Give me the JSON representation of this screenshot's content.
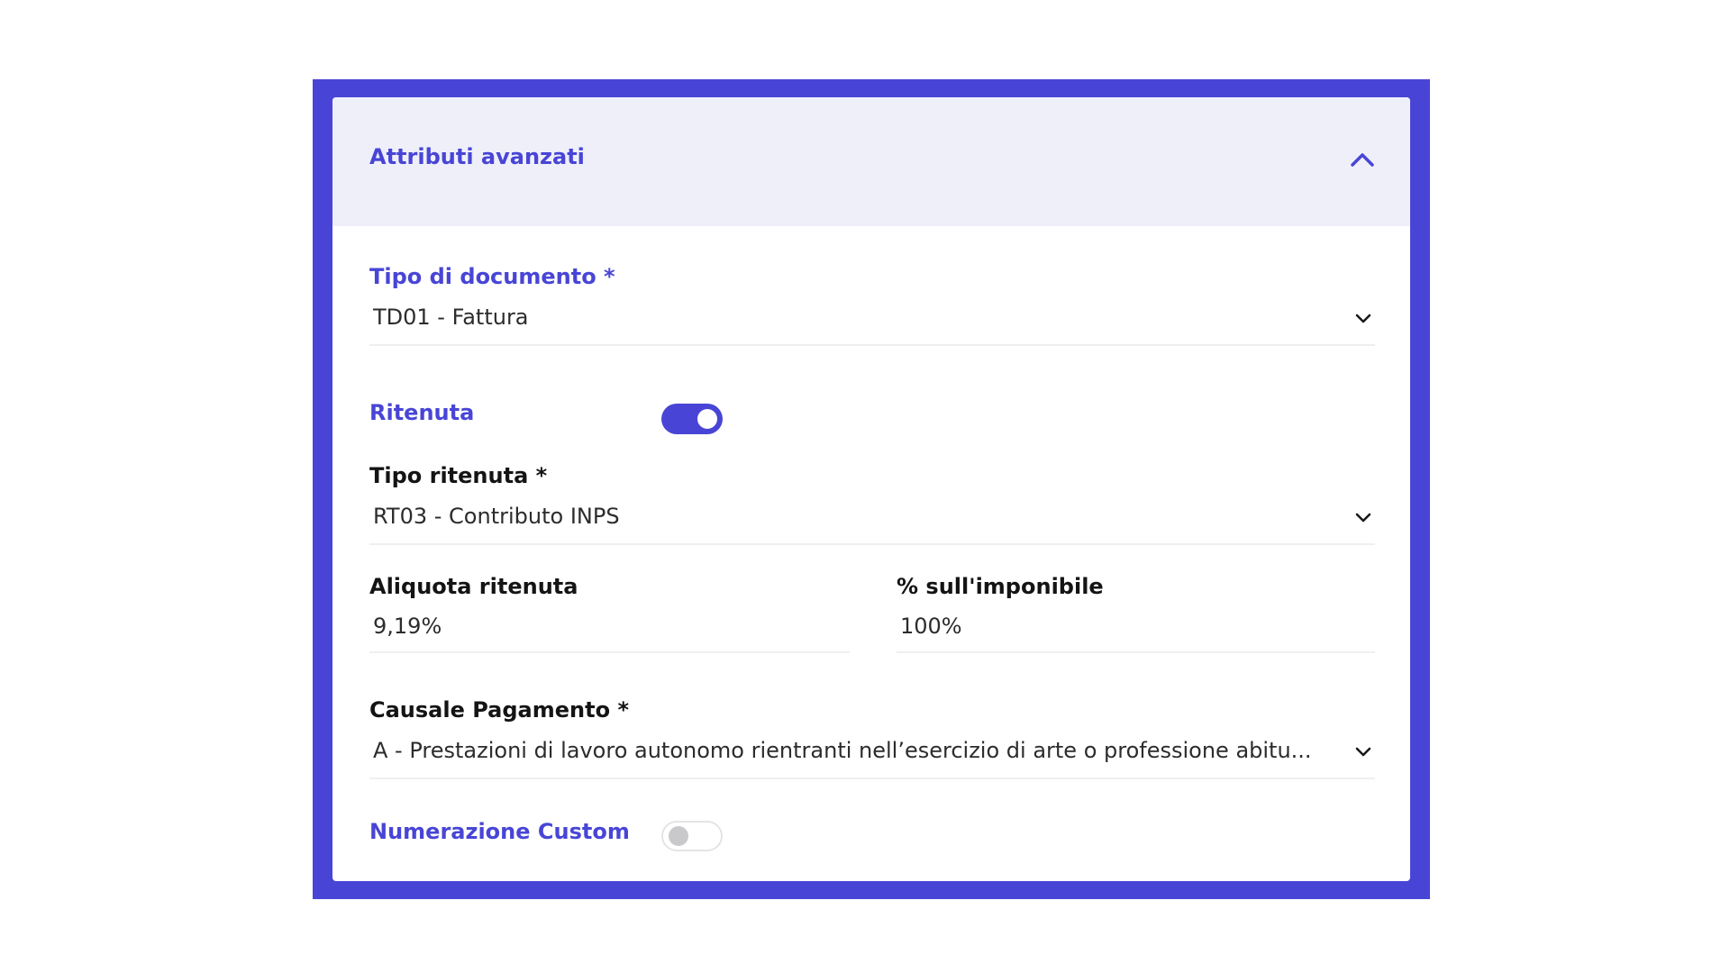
{
  "panel": {
    "title": "Attributi avanzati",
    "collapse_icon": "chevron-up-icon",
    "accent_color": "#4845d6"
  },
  "tipo_documento": {
    "label": "Tipo di documento *",
    "value": "TD01 - Fattura"
  },
  "ritenuta": {
    "label": "Ritenuta",
    "enabled": true
  },
  "tipo_ritenuta": {
    "label": "Tipo ritenuta *",
    "value": "RT03 - Contributo INPS"
  },
  "aliquota_ritenuta": {
    "label": "Aliquota ritenuta",
    "value": "9,19%"
  },
  "percentuale_imponibile": {
    "label": "% sull'imponibile",
    "value": "100%"
  },
  "causale_pagamento": {
    "label": "Causale Pagamento *",
    "value": "A - Prestazioni di lavoro autonomo rientranti nell’esercizio di arte o professione abitu..."
  },
  "numerazione_custom": {
    "label": "Numerazione Custom",
    "enabled": false
  }
}
